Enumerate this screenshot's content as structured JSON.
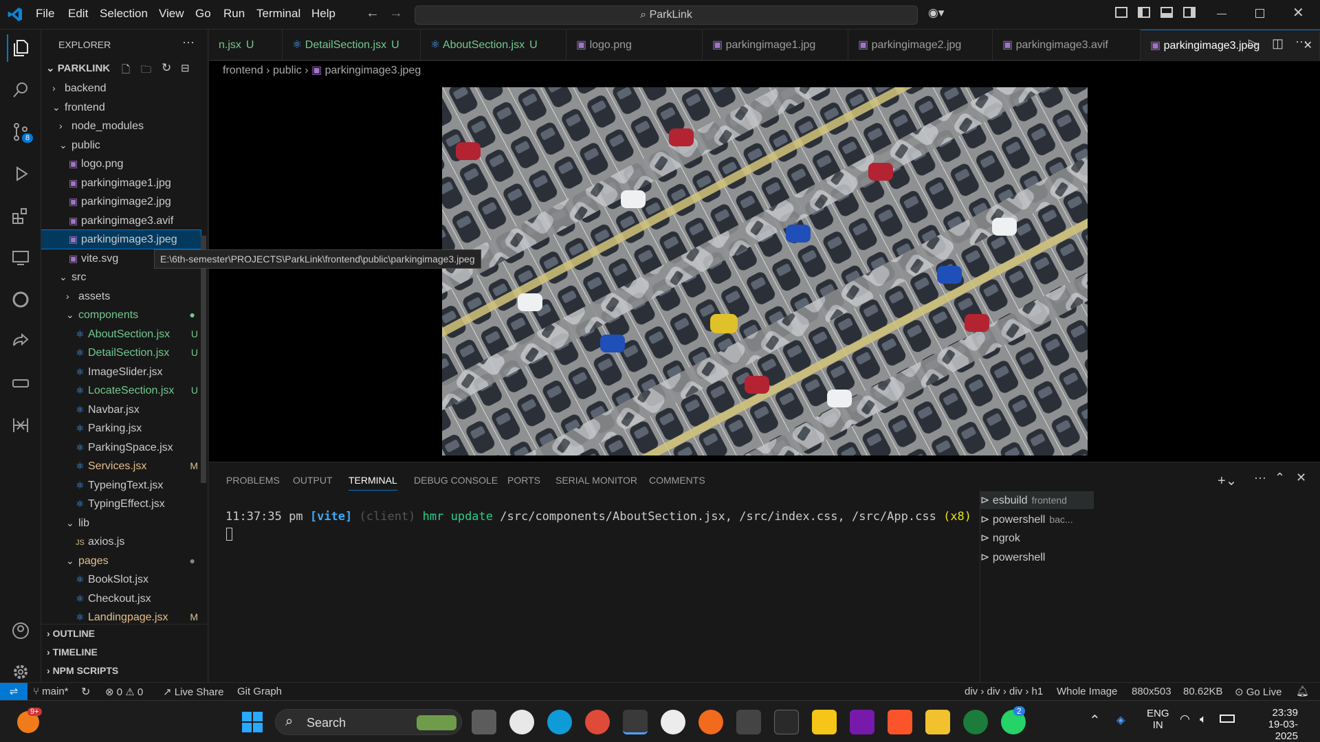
{
  "menu": [
    "File",
    "Edit",
    "Selection",
    "View",
    "Go",
    "Run",
    "Terminal",
    "Help"
  ],
  "command_center": "ParkLink",
  "explorer": {
    "title": "EXPLORER",
    "root": "PARKLINK"
  },
  "tree": [
    {
      "label": "backend",
      "depth": 1,
      "kind": "folder-closed"
    },
    {
      "label": "frontend",
      "depth": 1,
      "kind": "folder-open"
    },
    {
      "label": "node_modules",
      "depth": 2,
      "kind": "folder-closed"
    },
    {
      "label": "public",
      "depth": 2,
      "kind": "folder-open"
    },
    {
      "label": "logo.png",
      "depth": 3,
      "kind": "image"
    },
    {
      "label": "parkingimage1.jpg",
      "depth": 3,
      "kind": "image"
    },
    {
      "label": "parkingimage2.jpg",
      "depth": 3,
      "kind": "image"
    },
    {
      "label": "parkingimage3.avif",
      "depth": 3,
      "kind": "image"
    },
    {
      "label": "parkingimage3.jpeg",
      "depth": 3,
      "kind": "image",
      "selected": true
    },
    {
      "label": "vite.svg",
      "depth": 3,
      "kind": "image"
    },
    {
      "label": "src",
      "depth": 2,
      "kind": "folder-open"
    },
    {
      "label": "assets",
      "depth": 3,
      "kind": "folder-closed"
    },
    {
      "label": "components",
      "depth": 3,
      "kind": "folder-open",
      "color": "green"
    },
    {
      "label": "AboutSection.jsx",
      "depth": 4,
      "kind": "react",
      "color": "green",
      "badge": "U"
    },
    {
      "label": "DetailSection.jsx",
      "depth": 4,
      "kind": "react",
      "color": "green",
      "badge": "U"
    },
    {
      "label": "ImageSlider.jsx",
      "depth": 4,
      "kind": "react"
    },
    {
      "label": "LocateSection.jsx",
      "depth": 4,
      "kind": "react",
      "color": "green",
      "badge": "U"
    },
    {
      "label": "Navbar.jsx",
      "depth": 4,
      "kind": "react"
    },
    {
      "label": "Parking.jsx",
      "depth": 4,
      "kind": "react"
    },
    {
      "label": "ParkingSpace.jsx",
      "depth": 4,
      "kind": "react"
    },
    {
      "label": "Services.jsx",
      "depth": 4,
      "kind": "react",
      "color": "yellow",
      "badge": "M"
    },
    {
      "label": "TypeingText.jsx",
      "depth": 4,
      "kind": "react"
    },
    {
      "label": "TypingEffect.jsx",
      "depth": 4,
      "kind": "react"
    },
    {
      "label": "lib",
      "depth": 3,
      "kind": "folder-open"
    },
    {
      "label": "axios.js",
      "depth": 4,
      "kind": "js"
    },
    {
      "label": "pages",
      "depth": 3,
      "kind": "folder-open",
      "color": "yellow"
    },
    {
      "label": "BookSlot.jsx",
      "depth": 4,
      "kind": "react"
    },
    {
      "label": "Checkout.jsx",
      "depth": 4,
      "kind": "react"
    },
    {
      "label": "Landingpage.jsx",
      "depth": 4,
      "kind": "react",
      "color": "yellow",
      "badge": "M"
    }
  ],
  "sections": [
    "OUTLINE",
    "TIMELINE",
    "NPM SCRIPTS"
  ],
  "tooltip": "E:\\6th-semester\\PROJECTS\\ParkLink\\frontend\\public\\parkingimage3.jpeg",
  "tabs": [
    {
      "label": "n.jsx",
      "badge": "U",
      "kind": "react"
    },
    {
      "label": "DetailSection.jsx",
      "badge": "U",
      "kind": "react"
    },
    {
      "label": "AboutSection.jsx",
      "badge": "U",
      "kind": "react"
    },
    {
      "label": "logo.png",
      "kind": "image"
    },
    {
      "label": "parkingimage1.jpg",
      "kind": "image"
    },
    {
      "label": "parkingimage2.jpg",
      "kind": "image"
    },
    {
      "label": "parkingimage3.avif",
      "kind": "image"
    },
    {
      "label": "parkingimage3.jpeg",
      "kind": "image",
      "active": true
    }
  ],
  "breadcrumbs": [
    "frontend",
    "public",
    "parkingimage3.jpeg"
  ],
  "panel_tabs": [
    "PROBLEMS",
    "OUTPUT",
    "TERMINAL",
    "DEBUG CONSOLE",
    "PORTS",
    "SERIAL MONITOR",
    "COMMENTS"
  ],
  "terminal": {
    "time": "11:37:35 pm",
    "tag": "[vite]",
    "client": "(client)",
    "action": "hmr update",
    "files": "/src/components/AboutSection.jsx, /src/index.css, /src/App.css",
    "count": "(x8)"
  },
  "terminals": [
    {
      "label": "esbuild",
      "sub": "frontend"
    },
    {
      "label": "powershell",
      "sub": "bac..."
    },
    {
      "label": "ngrok"
    },
    {
      "label": "powershell"
    }
  ],
  "status": {
    "branch": "main*",
    "errors": "0",
    "warnings": "0",
    "liveshare": "Live Share",
    "gitgraph": "Git Graph",
    "path": "div › div › div › h1",
    "zoom": "Whole Image",
    "size": "880x503",
    "filesize": "80.62KB",
    "golive": "Go Live"
  },
  "taskbar": {
    "search": "Search",
    "lang": "ENG",
    "region": "IN",
    "time": "23:39",
    "date": "19-03-2025",
    "notif": "9+",
    "whatsapp": "2"
  }
}
